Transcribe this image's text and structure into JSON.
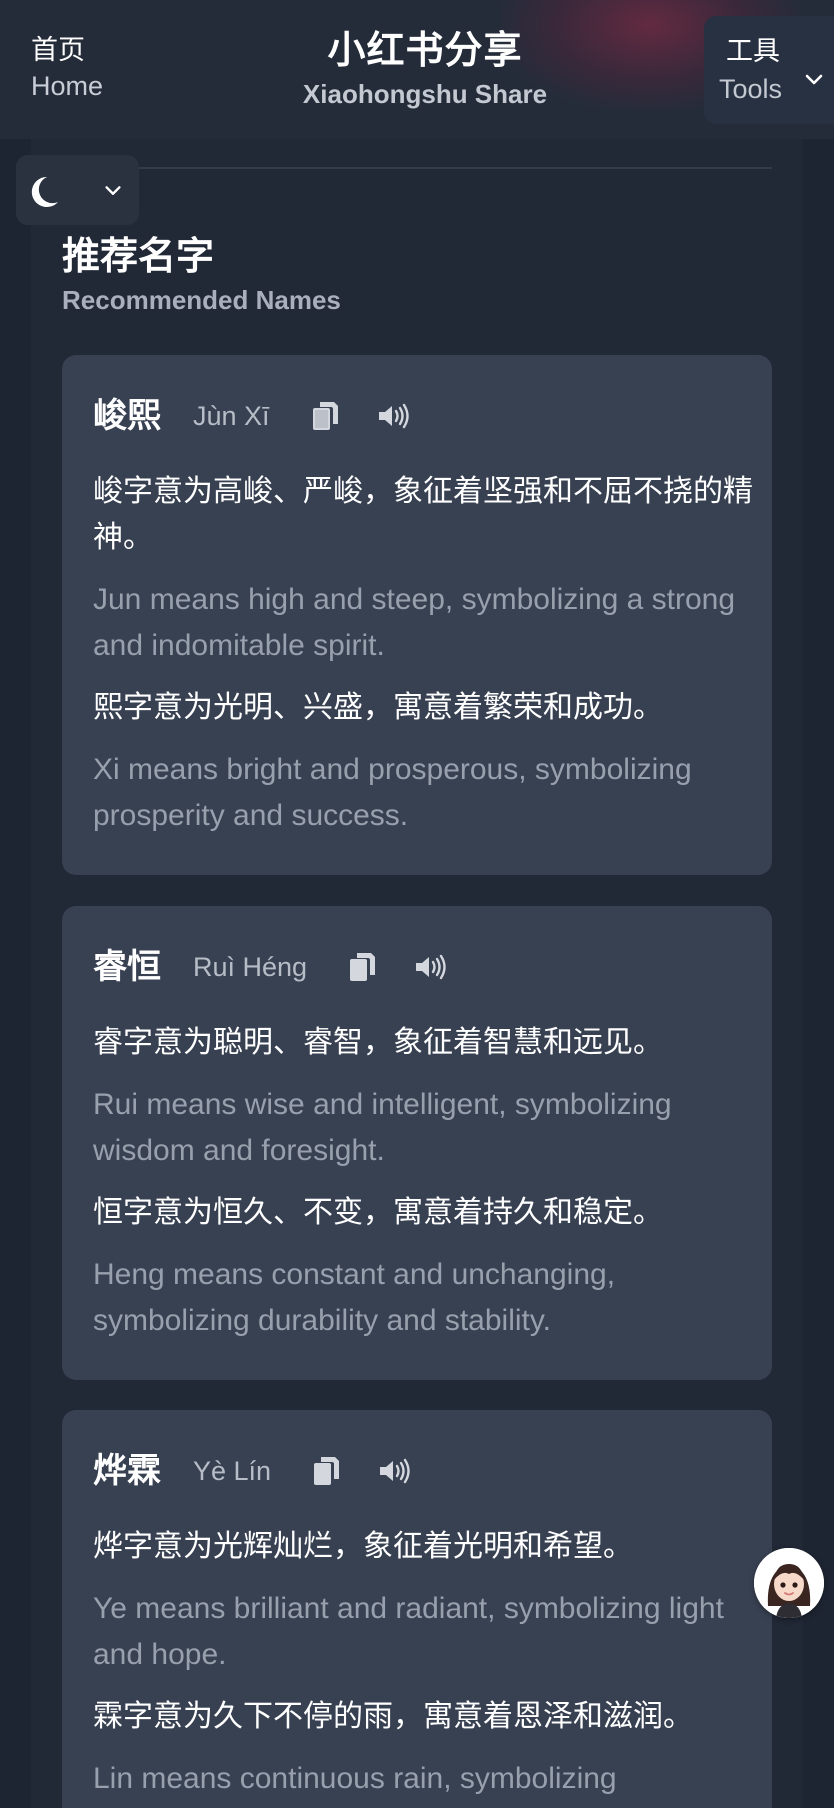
{
  "header": {
    "home_zh": "首页",
    "home_en": "Home",
    "brand_zh": "小红书分享",
    "brand_en": "Xiaohongshu Share",
    "tools_zh": "工具",
    "tools_en": "Tools"
  },
  "section": {
    "title_zh": "推荐名字",
    "title_en": "Recommended Names"
  },
  "names": [
    {
      "name": "峻熙",
      "pinyin": "Jùn Xī",
      "meanings": [
        {
          "zh": "峻字意为高峻、严峻，象征着坚强和不屈不挠的精神。",
          "en": "Jun means high and steep, symbolizing a strong and indomitable spirit."
        },
        {
          "zh": "熙字意为光明、兴盛，寓意着繁荣和成功。",
          "en": "Xi means bright and prosperous, symbolizing prosperity and success."
        }
      ]
    },
    {
      "name": "睿恒",
      "pinyin": "Ruì Héng",
      "meanings": [
        {
          "zh": "睿字意为聪明、睿智，象征着智慧和远见。",
          "en": "Rui means wise and intelligent, symbolizing wisdom and foresight."
        },
        {
          "zh": "恒字意为恒久、不变，寓意着持久和稳定。",
          "en": "Heng means constant and unchanging, symbolizing durability and stability."
        }
      ]
    },
    {
      "name": "烨霖",
      "pinyin": "Yè Lín",
      "meanings": [
        {
          "zh": "烨字意为光辉灿烂，象征着光明和希望。",
          "en": "Ye means brilliant and radiant, symbolizing light and hope."
        },
        {
          "zh": "霖字意为久下不停的雨，寓意着恩泽和滋润。",
          "en": "Lin means continuous rain, symbolizing"
        }
      ]
    }
  ],
  "icons": {
    "copy": "copy-icon",
    "speak": "speaker-icon",
    "theme": "moon-icon",
    "dropdown": "chevron-down-icon"
  },
  "colors": {
    "page_bg": "#1e2532",
    "card_bg": "#384152",
    "header_bg": "#242c3a",
    "muted_text": "#98a0ad"
  }
}
